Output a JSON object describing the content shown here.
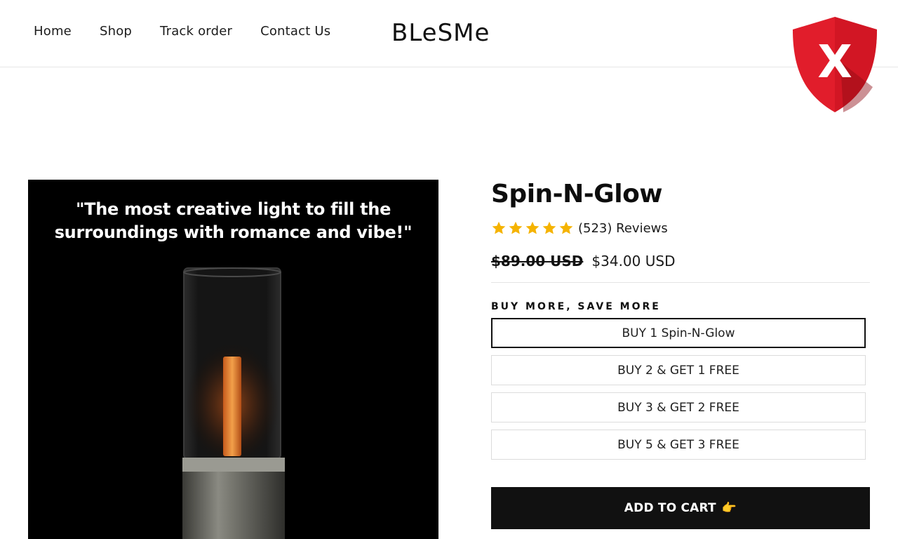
{
  "nav": {
    "items": [
      {
        "label": "Home"
      },
      {
        "label": "Shop"
      },
      {
        "label": "Track order"
      },
      {
        "label": "Contact Us"
      }
    ]
  },
  "brand": {
    "logo_text": "BLeSMe"
  },
  "security_badge": {
    "icon": "shield-x-icon",
    "glyph": "X",
    "color": "#e11d2b"
  },
  "gallery": {
    "quote_line1": "\"The most creative light to fill the",
    "quote_line2": "surroundings with romance and vibe!\""
  },
  "product": {
    "title": "Spin-N-Glow",
    "rating_stars": 5,
    "review_count": "(523)",
    "reviews_label": "Reviews",
    "star_color": "#f5b301",
    "old_price": "$89.00 USD",
    "new_price": "$34.00 USD",
    "bundle_label": "BUY MORE, SAVE MORE",
    "options": [
      {
        "label": "BUY 1 Spin-N-Glow",
        "selected": true
      },
      {
        "label": "BUY 2 & GET 1 FREE",
        "selected": false
      },
      {
        "label": "BUY 3 & GET 2 FREE",
        "selected": false
      },
      {
        "label": "BUY 5 & GET 3 FREE",
        "selected": false
      }
    ],
    "add_to_cart_label": "ADD TO CART",
    "add_to_cart_icon": "pointing-hand-icon",
    "add_to_cart_emoji": "👉"
  }
}
